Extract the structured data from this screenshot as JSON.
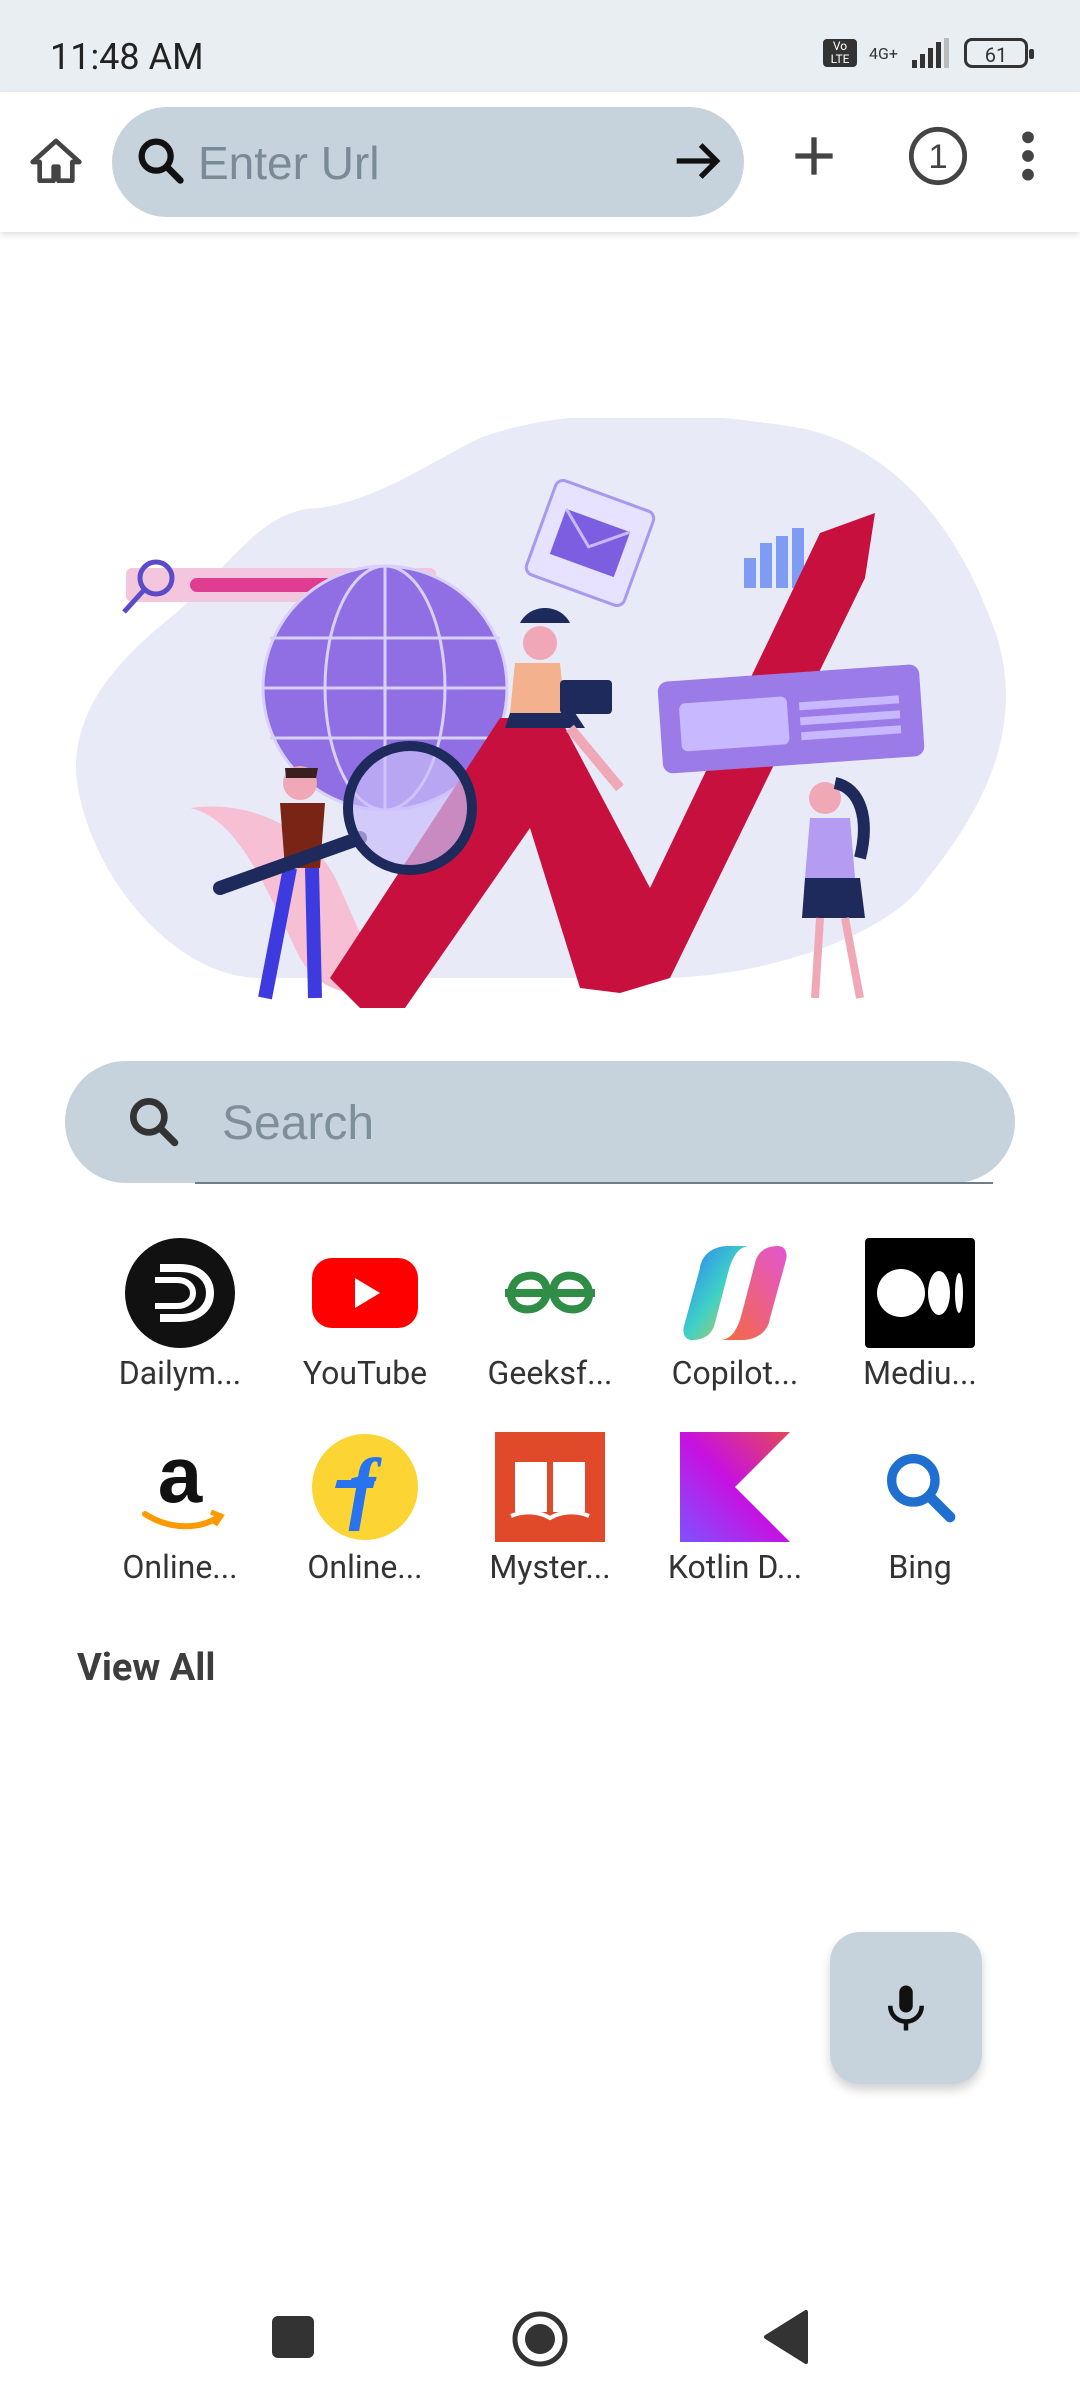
{
  "status_bar": {
    "time": "11:48 AM",
    "volte": "Vo LTE",
    "network": "4G+",
    "battery": "61"
  },
  "toolbar": {
    "url_placeholder": "Enter Url",
    "tab_count": "1"
  },
  "search": {
    "placeholder": "Search"
  },
  "shortcuts": [
    {
      "label": "Dailym...",
      "icon": "dailyhunt-icon"
    },
    {
      "label": "YouTube",
      "icon": "youtube-icon"
    },
    {
      "label": "Geeksf...",
      "icon": "geeksforgeeks-icon"
    },
    {
      "label": "Copilot...",
      "icon": "copilot-icon"
    },
    {
      "label": "Mediu...",
      "icon": "medium-icon"
    },
    {
      "label": "Online...",
      "icon": "amazon-icon"
    },
    {
      "label": "Online...",
      "icon": "flipkart-icon"
    },
    {
      "label": "Myster...",
      "icon": "book-icon"
    },
    {
      "label": "Kotlin D...",
      "icon": "kotlin-icon"
    },
    {
      "label": "Bing",
      "icon": "bing-search-icon"
    }
  ],
  "view_all": "View All",
  "colors": {
    "pill_bg": "#c7d3dc",
    "status_bg": "#e9eef3",
    "accent_red": "#c8103e",
    "illustration_purple": "#8f6fe3"
  }
}
